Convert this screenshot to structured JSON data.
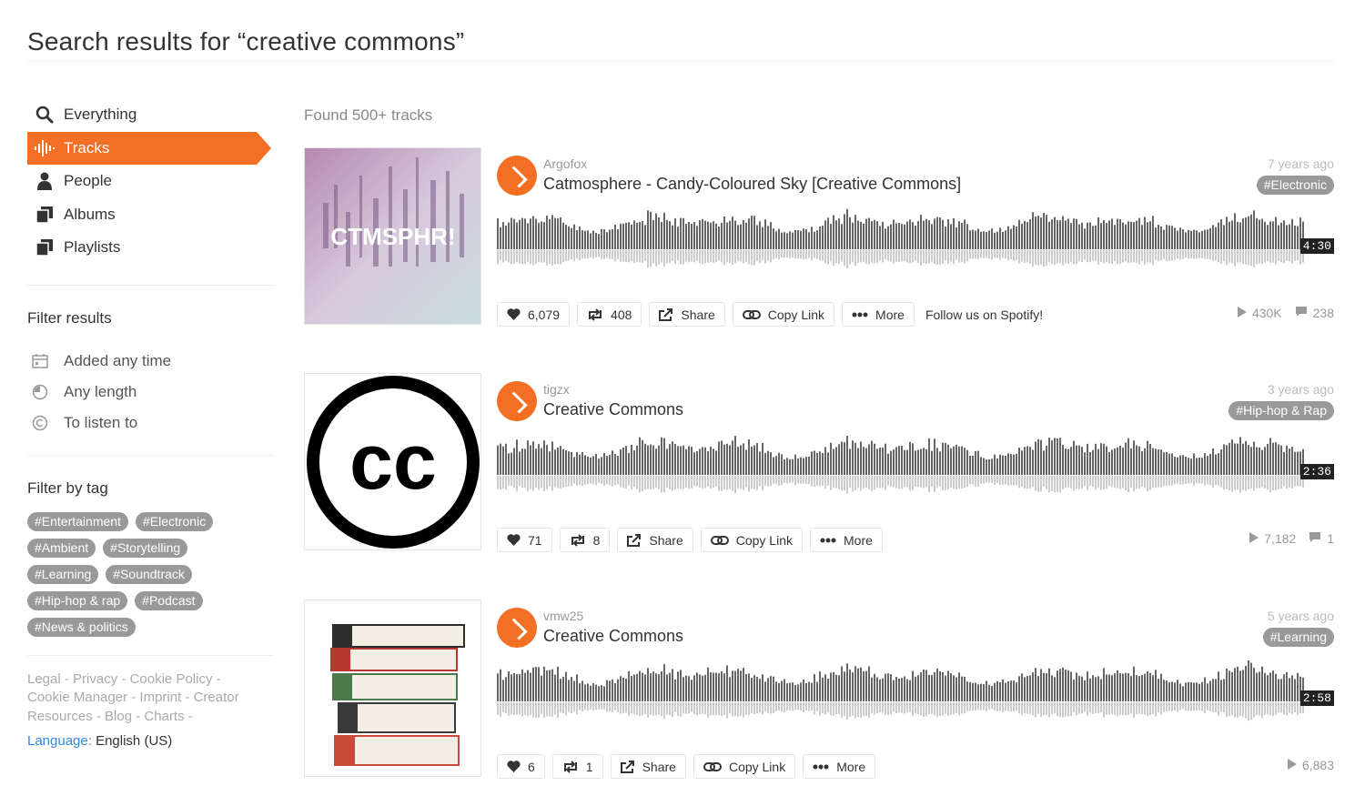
{
  "page": {
    "title": "Search results for “creative commons”"
  },
  "sidebar": {
    "nav": [
      {
        "label": "Everything",
        "icon": "search-icon"
      },
      {
        "label": "Tracks",
        "icon": "soundwave-icon",
        "active": true
      },
      {
        "label": "People",
        "icon": "person-icon"
      },
      {
        "label": "Albums",
        "icon": "album-icon"
      },
      {
        "label": "Playlists",
        "icon": "playlist-icon"
      }
    ],
    "filter_heading": "Filter results",
    "filters": [
      {
        "label": "Added any time",
        "icon": "calendar-icon"
      },
      {
        "label": "Any length",
        "icon": "clock-icon"
      },
      {
        "label": "To listen to",
        "icon": "copyright-icon"
      }
    ],
    "tag_heading": "Filter by tag",
    "tags": [
      "#Entertainment",
      "#Electronic",
      "#Ambient",
      "#Storytelling",
      "#Learning",
      "#Soundtrack",
      "#Hip-hop & rap",
      "#Podcast",
      "#News & politics"
    ],
    "footer_links": [
      "Legal",
      "Privacy",
      "Cookie Policy",
      "Cookie Manager",
      "Imprint",
      "Creator Resources",
      "Blog",
      "Charts"
    ],
    "language_label": "Language:",
    "language_value": "English (US)"
  },
  "results": {
    "found": "Found 500+ tracks",
    "tracks": [
      {
        "user": "Argofox",
        "title": "Catmosphere - Candy-Coloured Sky [Creative Commons]",
        "ago": "7 years ago",
        "genre": "#Electronic",
        "duration": "4:30",
        "likes": "6,079",
        "reposts": "408",
        "share": "Share",
        "copy_link": "Copy Link",
        "more": "More",
        "extra": "Follow us on Spotify!",
        "plays": "430K",
        "comments": "238",
        "art_text": "CTMSPHR!"
      },
      {
        "user": "tigzx",
        "title": "Creative Commons",
        "ago": "3 years ago",
        "genre": "#Hip-hop & Rap",
        "duration": "2:36",
        "likes": "71",
        "reposts": "8",
        "share": "Share",
        "copy_link": "Copy Link",
        "more": "More",
        "plays": "7,182",
        "comments": "1",
        "art_text": "cc"
      },
      {
        "user": "vmw25",
        "title": "Creative Commons",
        "ago": "5 years ago",
        "genre": "#Learning",
        "duration": "2:58",
        "likes": "6",
        "reposts": "1",
        "share": "Share",
        "copy_link": "Copy Link",
        "more": "More",
        "plays": "6,883"
      }
    ]
  },
  "colors": {
    "accent": "#f26f23",
    "tag_bg": "#999999",
    "waveform": "#666666",
    "waveform_reflection": "#cccccc"
  }
}
